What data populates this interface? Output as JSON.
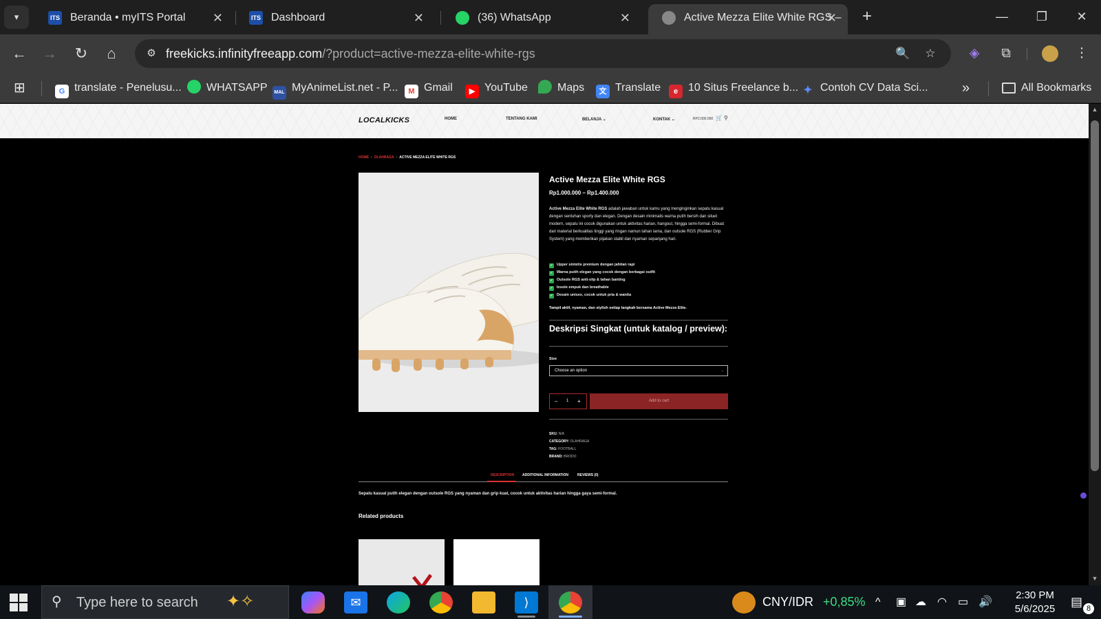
{
  "browser": {
    "tabs": [
      {
        "title": "Beranda • myITS Portal",
        "favicon": "ITS"
      },
      {
        "title": "Dashboard",
        "favicon": "ITS"
      },
      {
        "title": "(36) WhatsApp",
        "favicon": "whatsapp-icon"
      },
      {
        "title": "Active Mezza Elite White RGS –",
        "favicon": "globe-icon",
        "active": true
      }
    ],
    "url_host": "freekicks.infinityfreeapp.com",
    "url_path": "/?product=active-mezza-elite-white-rgs",
    "bookmarks": [
      {
        "label": "translate - Penelusu...",
        "icon": "google-icon"
      },
      {
        "label": "WHATSAPP",
        "icon": "whatsapp-icon"
      },
      {
        "label": "MyAnimeList.net - P...",
        "icon": "MAL"
      },
      {
        "label": "Gmail",
        "icon": "gmail-icon"
      },
      {
        "label": "YouTube",
        "icon": "youtube-icon"
      },
      {
        "label": "Maps",
        "icon": "maps-icon"
      },
      {
        "label": "Translate",
        "icon": "translate-icon"
      },
      {
        "label": "10 Situs Freelance b...",
        "icon": "bookmark-icon"
      },
      {
        "label": "Contoh CV Data Sci...",
        "icon": "bookmark-icon"
      }
    ],
    "all_bookmarks": "All Bookmarks",
    "more_bookmarks": "»"
  },
  "site": {
    "logo": "LOCALKICKS",
    "nav": [
      "HOME",
      "TENTANG KAMI",
      "BELANJA ⌄",
      "KONTAK ⌄"
    ],
    "cart_total": "RP2.000.000"
  },
  "product": {
    "breadcrumb": [
      "HOME",
      "OLAHRAGA",
      "ACTIVE MEZZA ELITE WHITE RGS"
    ],
    "title": "Active Mezza Elite White RGS",
    "price": "Rp1.000.000 – Rp1.400.000",
    "description_bold": "Active Mezza Elite White RGS",
    "description_rest": " adalah jawaban untuk kamu yang menginginkan sepatu kasual dengan sentuhan sporty dan elegan. Dengan desain minimalis warna putih bersih dan siluet modern, sepatu ini cocok digunakan untuk aktivitas harian, hangout, hingga semi-formal. Dibuat dari material berkualitas tinggi yang ringan namun tahan lama, dan outsole RGS (Rubber Grip System) yang memberikan pijakan stabil dan nyaman sepanjang hari.",
    "features": [
      "Upper sintetis premium dengan jahitan rapi",
      "Warna putih elegan yang cocok dengan berbagai outfit",
      "Outsole RGS anti-slip & tahan banting",
      "Insole empuk dan breathable",
      "Desain unisex, cocok untuk pria & wanita"
    ],
    "tagline": "Tampil aktif, nyaman, dan stylish setiap langkah bersama Active Mezza Elite.",
    "short_desc_heading": "Deskripsi Singkat (untuk katalog / preview):",
    "size_label": "Size",
    "size_placeholder": "Choose an option",
    "qty": "1",
    "qty_minus": "–",
    "qty_plus": "+",
    "add_to_cart": "Add to cart",
    "meta": {
      "sku_label": "SKU:",
      "sku": "N/A",
      "category_label": "CATEGORY:",
      "category": "OLAHRAGA",
      "tag_label": "TAG:",
      "tag": "FOOTBALL",
      "brand_label": "BRAND:",
      "brand": "BRODO"
    },
    "tabs": [
      "DESCRIPTION",
      "ADDITIONAL INFORMATION",
      "REVIEWS (0)"
    ],
    "tab_content": "Sepatu kasual putih elegan dengan outsole RGS yang nyaman dan grip kuat, cocok untuk aktivitas harian hingga gaya semi-formal.",
    "related_heading": "Related products"
  },
  "taskbar": {
    "search_placeholder": "Type here to search",
    "currency": "CNY/IDR",
    "currency_change": "+0,85%",
    "time": "2:30 PM",
    "date": "5/6/2025",
    "notifications": "8"
  },
  "colors": {
    "accent": "#d33333",
    "cart_button": "#8b2424",
    "positive": "#3ddc84"
  }
}
